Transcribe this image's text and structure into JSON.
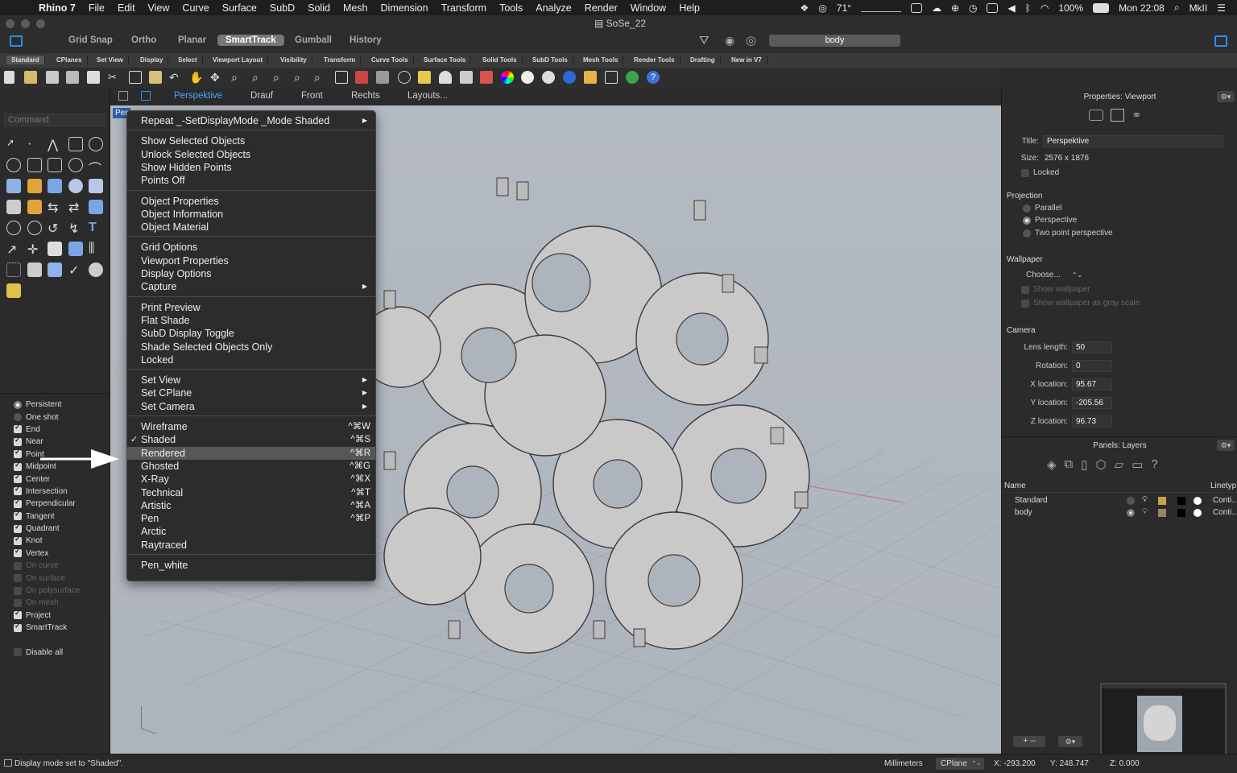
{
  "menubar": {
    "app": "Rhino 7",
    "items": [
      "File",
      "Edit",
      "View",
      "Curve",
      "Surface",
      "SubD",
      "Solid",
      "Mesh",
      "Dimension",
      "Transform",
      "Tools",
      "Analyze",
      "Render",
      "Window",
      "Help"
    ],
    "temperature": "71°",
    "battery": "100%",
    "clock": "Mon 22:08",
    "user": "MkII"
  },
  "document_title": "SoSe_22",
  "snapbar": {
    "items": [
      "Grid Snap",
      "Ortho",
      "Planar",
      "SmartTrack",
      "Gumball",
      "History"
    ],
    "active": "SmartTrack",
    "current_layer": "body"
  },
  "toolbar_tabs": [
    "Standard",
    "CPlanes",
    "Set View",
    "Display",
    "Select",
    "Viewport Layout",
    "Visibility",
    "Transform",
    "Curve Tools",
    "Surface Tools",
    "Solid Tools",
    "SubD Tools",
    "Mesh Tools",
    "Render Tools",
    "Drafting",
    "New in V7"
  ],
  "command_placeholder": "Command",
  "viewport_tabs": [
    "Perspektive",
    "Drauf",
    "Front",
    "Rechts",
    "Layouts..."
  ],
  "viewport_label": "Per",
  "context_menu": {
    "repeat": "Repeat _-SetDisplayMode _Mode Shaded",
    "group1": [
      "Show Selected Objects",
      "Unlock Selected Objects",
      "Show Hidden Points",
      "Points Off"
    ],
    "group2": [
      "Object Properties",
      "Object Information",
      "Object Material"
    ],
    "group3": [
      "Grid Options",
      "Viewport Properties",
      "Display Options",
      "Capture"
    ],
    "group4": [
      "Print Preview",
      "Flat Shade",
      "SubD Display Toggle",
      "Shade Selected Objects Only",
      "Locked"
    ],
    "group5": [
      "Set View",
      "Set CPlane",
      "Set Camera"
    ],
    "modes": [
      {
        "label": "Wireframe",
        "shortcut": "^⌘W"
      },
      {
        "label": "Shaded",
        "shortcut": "^⌘S"
      },
      {
        "label": "Rendered",
        "shortcut": "^⌘R"
      },
      {
        "label": "Ghosted",
        "shortcut": "^⌘G"
      },
      {
        "label": "X-Ray",
        "shortcut": "^⌘X"
      },
      {
        "label": "Technical",
        "shortcut": "^⌘T"
      },
      {
        "label": "Artistic",
        "shortcut": "^⌘A"
      },
      {
        "label": "Pen",
        "shortcut": "^⌘P"
      },
      {
        "label": "Arctic",
        "shortcut": ""
      },
      {
        "label": "Raytraced",
        "shortcut": ""
      }
    ],
    "checked": "Shaded",
    "highlighted": "Rendered",
    "last": "Pen_white"
  },
  "osnap": {
    "modes": [
      {
        "label": "Persistent",
        "type": "radio",
        "state": "selected"
      },
      {
        "label": "One shot",
        "type": "radio",
        "state": "off"
      }
    ],
    "items": [
      {
        "label": "End",
        "checked": true,
        "enabled": true
      },
      {
        "label": "Near",
        "checked": true,
        "enabled": true
      },
      {
        "label": "Point",
        "checked": true,
        "enabled": true
      },
      {
        "label": "Midpoint",
        "checked": true,
        "enabled": true
      },
      {
        "label": "Center",
        "checked": true,
        "enabled": true
      },
      {
        "label": "Intersection",
        "checked": true,
        "enabled": true
      },
      {
        "label": "Perpendicular",
        "checked": true,
        "enabled": true
      },
      {
        "label": "Tangent",
        "checked": true,
        "enabled": true
      },
      {
        "label": "Quadrant",
        "checked": true,
        "enabled": true
      },
      {
        "label": "Knot",
        "checked": true,
        "enabled": true
      },
      {
        "label": "Vertex",
        "checked": true,
        "enabled": true
      },
      {
        "label": "On curve",
        "checked": false,
        "enabled": false
      },
      {
        "label": "On surface",
        "checked": false,
        "enabled": false
      },
      {
        "label": "On polysurface",
        "checked": false,
        "enabled": false
      },
      {
        "label": "On mesh",
        "checked": false,
        "enabled": false
      },
      {
        "label": "Project",
        "checked": true,
        "enabled": true
      },
      {
        "label": "SmartTrack",
        "checked": true,
        "enabled": true
      }
    ],
    "disable_all": "Disable all"
  },
  "properties": {
    "header": "Properties: Viewport",
    "title_label": "Title:",
    "title_value": "Perspektive",
    "size_label": "Size:",
    "size_value": "2576 x 1876",
    "locked_label": "Locked",
    "projection_header": "Projection",
    "projections": [
      "Parallel",
      "Perspective",
      "Two point perspective"
    ],
    "projection_selected": "Perspective",
    "wallpaper_header": "Wallpaper",
    "wallpaper_choose": "Choose...",
    "show_wallpaper": "Show wallpaper",
    "show_wallpaper_gray": "Show wallpaper as gray scale",
    "camera_header": "Camera",
    "camera": [
      {
        "label": "Lens length:",
        "value": "50"
      },
      {
        "label": "Rotation:",
        "value": "0"
      },
      {
        "label": "X location:",
        "value": "95.67"
      },
      {
        "label": "Y location:",
        "value": "-205.56"
      },
      {
        "label": "Z location:",
        "value": "96.73"
      }
    ]
  },
  "layers": {
    "header": "Panels: Layers",
    "col_name": "Name",
    "col_linetype": "Linetyp",
    "rows": [
      {
        "name": "Standard",
        "linetype": "Conti..."
      },
      {
        "name": "body",
        "linetype": "Conti..."
      }
    ]
  },
  "status": {
    "message": "Display mode set to \"Shaded\".",
    "units": "Millimeters",
    "cplane": "CPlane",
    "x": "X: -293.200",
    "y": "Y: 248.747",
    "z": "Z: 0.000"
  },
  "colors": {
    "accent": "#2d8cf0",
    "active_tab": "#4aa3ff",
    "viewport_bg": "#b1b7be",
    "menu_bg": "#2c2c2c",
    "menu_highlight": "#575757"
  }
}
